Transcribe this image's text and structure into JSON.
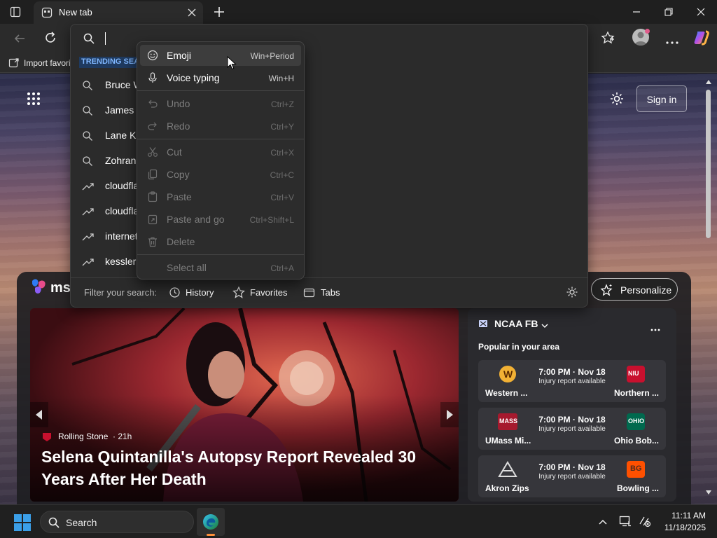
{
  "browser": {
    "tab_title": "New tab",
    "favorites_bar": {
      "import_label": "Import favori"
    },
    "address_bar": {
      "value": ""
    }
  },
  "dropdown": {
    "trending_label": "TRENDING SEARC",
    "suggestions": [
      {
        "text": "Bruce W",
        "icon": "search-icon"
      },
      {
        "text": "James F",
        "icon": "search-icon"
      },
      {
        "text": "Lane Ki",
        "icon": "search-icon"
      },
      {
        "text": "Zohran",
        "icon": "search-icon"
      },
      {
        "text": "cloudfla",
        "icon": "trending-icon"
      },
      {
        "text": "cloudfla",
        "icon": "trending-icon"
      },
      {
        "text": "internet",
        "icon": "trending-icon"
      },
      {
        "text": "kessler",
        "icon": "trending-icon"
      }
    ],
    "filter_label": "Filter your search:",
    "filters": [
      "History",
      "Favorites",
      "Tabs"
    ]
  },
  "context_menu": {
    "items": [
      {
        "label": "Emoji",
        "shortcut": "Win+Period",
        "enabled": true,
        "icon": "emoji-icon",
        "highlighted": true
      },
      {
        "label": "Voice typing",
        "shortcut": "Win+H",
        "enabled": true,
        "icon": "microphone-icon"
      },
      {
        "label": "Undo",
        "shortcut": "Ctrl+Z",
        "enabled": false,
        "icon": "undo-icon"
      },
      {
        "label": "Redo",
        "shortcut": "Ctrl+Y",
        "enabled": false,
        "icon": "redo-icon"
      },
      {
        "label": "Cut",
        "shortcut": "Ctrl+X",
        "enabled": false,
        "icon": "scissors-icon"
      },
      {
        "label": "Copy",
        "shortcut": "Ctrl+C",
        "enabled": false,
        "icon": "copy-icon"
      },
      {
        "label": "Paste",
        "shortcut": "Ctrl+V",
        "enabled": false,
        "icon": "paste-icon"
      },
      {
        "label": "Paste and go",
        "shortcut": "Ctrl+Shift+L",
        "enabled": false,
        "icon": "paste-go-icon"
      },
      {
        "label": "Delete",
        "shortcut": "",
        "enabled": false,
        "icon": "trash-icon"
      },
      {
        "label": "Select all",
        "shortcut": "Ctrl+A",
        "enabled": false,
        "icon": ""
      }
    ]
  },
  "newtab": {
    "sign_in": "Sign in",
    "msn_label": "msn",
    "personalize": "Personalize",
    "article": {
      "source": "Rolling Stone",
      "age": "· 21h",
      "headline": "Selena Quintanilla's Autopsy Report Revealed 30 Years After Her Death"
    },
    "sports": {
      "league": "NCAA FB",
      "subtitle": "Popular in your area",
      "games": [
        {
          "time": "7:00 PM · Nov 18",
          "note": "Injury report available",
          "home": "Western ...",
          "away": "Northern ..."
        },
        {
          "time": "7:00 PM · Nov 18",
          "note": "Injury report available",
          "home": "UMass Mi...",
          "away": "Ohio Bob..."
        },
        {
          "time": "7:00 PM · Nov 18",
          "note": "Injury report available",
          "home": "Akron Zips",
          "away": "Bowling ..."
        }
      ]
    }
  },
  "taskbar": {
    "search_label": "Search",
    "time": "11:11 AM",
    "date": "11/18/2025"
  },
  "colors": {
    "accent": "#3b8eea",
    "menu_bg": "#2c2c2c",
    "highlight": "#3d3d3d"
  }
}
